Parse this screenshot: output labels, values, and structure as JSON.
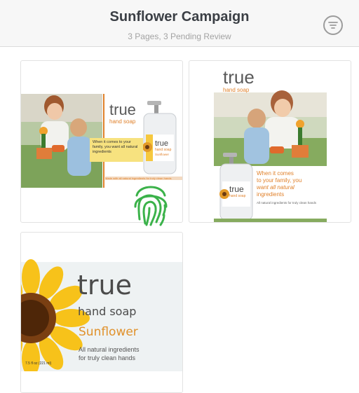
{
  "header": {
    "title": "Sunflower Campaign",
    "subtitle": "3 Pages, 3 Pending Review",
    "filter_icon": "filter-icon"
  },
  "pages": [
    {
      "brand": "true",
      "product": "hand soap",
      "headline": "When it comes to your family, you want all natural ingredients",
      "bottle_brand": "true",
      "bottle_product": "hand soap",
      "bottle_variant": "Sunflower",
      "footer_text": "Made with all natural ingredients for truly clean hands"
    },
    {
      "brand": "true",
      "product": "hand soap",
      "headline_1": "When it comes",
      "headline_2": "to your family, you",
      "headline_3": "want all natural",
      "headline_4": "ingredients",
      "footer_text": "All natural ingredients for truly clean hands",
      "bottle_brand": "true",
      "bottle_product": "hand soap"
    },
    {
      "brand": "true",
      "product": "hand soap",
      "variant": "Sunflower",
      "tagline_1": "All natural ingredients",
      "tagline_2": "for truly clean hands",
      "size": "7.5 fl oz (221 ml)"
    }
  ],
  "overlay": {
    "icon": "fingerprint-icon"
  },
  "colors": {
    "accent_orange": "#e0812b",
    "label_yellow": "#f6c83e",
    "text_dark": "#3b3f45"
  }
}
